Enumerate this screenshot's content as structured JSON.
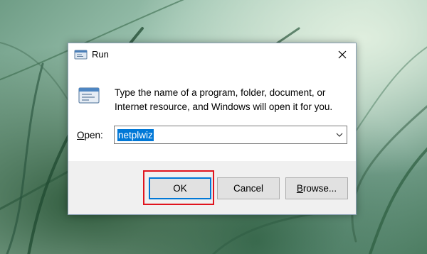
{
  "window": {
    "title": "Run",
    "close_icon": "close-icon",
    "title_icon": "run-icon"
  },
  "body": {
    "description": "Type the name of a program, folder, document, or Internet resource, and Windows will open it for you.",
    "open_label_first": "O",
    "open_label_rest": "pen:",
    "input_value": "netplwiz"
  },
  "buttons": {
    "ok": "OK",
    "cancel": "Cancel",
    "browse_first": "B",
    "browse_rest": "rowse..."
  },
  "colors": {
    "selection": "#0078d7",
    "highlight": "#e0141e",
    "footer": "#f0f0f0"
  }
}
